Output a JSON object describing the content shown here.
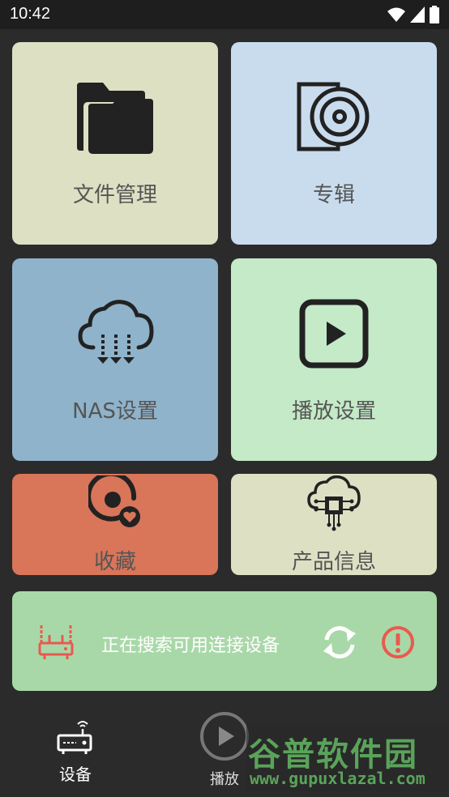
{
  "status_bar": {
    "time": "10:42"
  },
  "tiles": {
    "file_manager": {
      "label": "文件管理",
      "icon": "folder-icon"
    },
    "album": {
      "label": "专辑",
      "icon": "disc-icon"
    },
    "nas_settings": {
      "label": "NAS设置",
      "icon": "cloud-download-icon"
    },
    "play_settings": {
      "label": "播放设置",
      "icon": "play-square-icon"
    },
    "favorites": {
      "label": "收藏",
      "icon": "disc-heart-icon"
    },
    "product_info": {
      "label": "产品信息",
      "icon": "cloud-chip-icon"
    }
  },
  "device_search": {
    "status_text": "正在搜索可用连接设备",
    "colors": {
      "router": "#e85a4f",
      "alert": "#e85a4f"
    }
  },
  "bottom_nav": {
    "items": [
      {
        "label": "设备",
        "icon": "router-icon"
      },
      {
        "label": "播放",
        "icon": "play-circle-icon"
      }
    ]
  },
  "watermark": {
    "title": "谷普软件园",
    "url": "www.gupuxlazal.com"
  }
}
